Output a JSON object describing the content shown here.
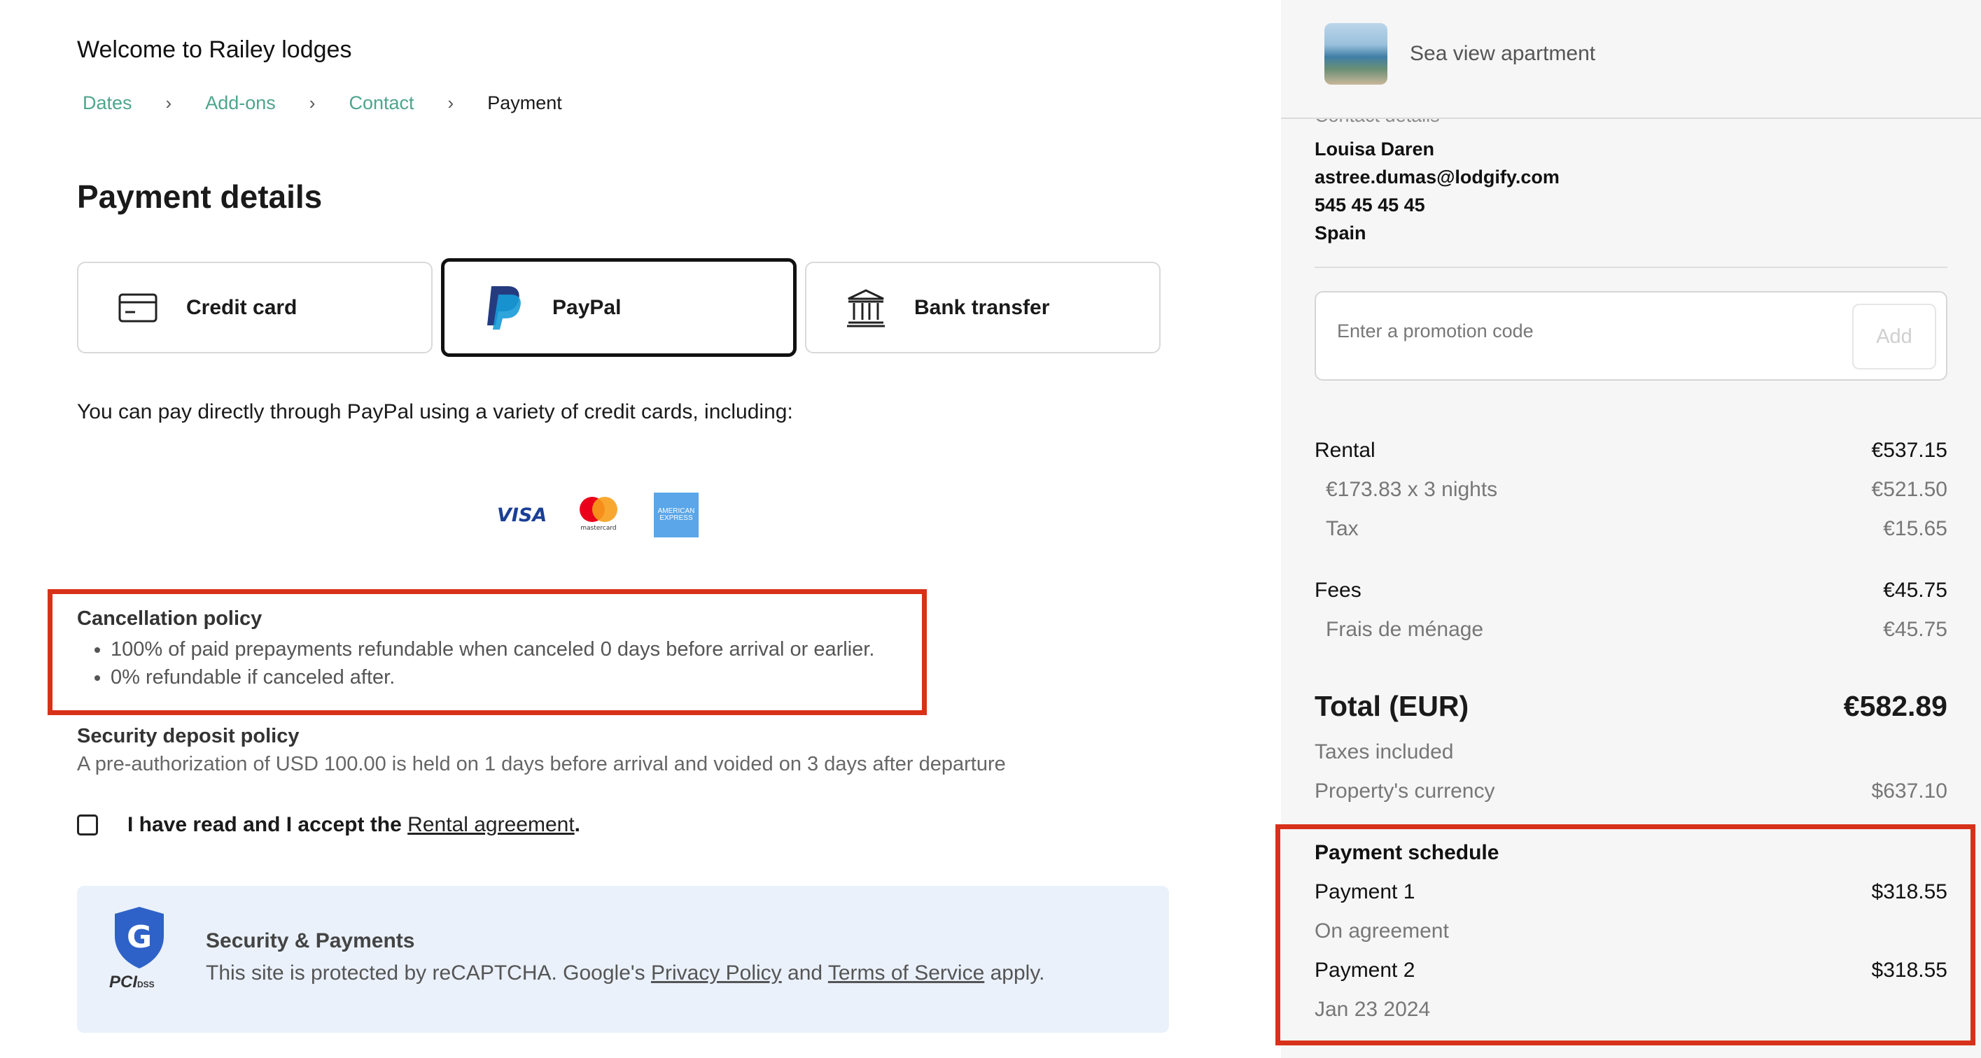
{
  "header": {
    "welcome": "Welcome to Railey lodges"
  },
  "breadcrumb": {
    "items": [
      "Dates",
      "Add-ons",
      "Contact",
      "Payment"
    ],
    "separator": "›"
  },
  "page_title": "Payment details",
  "payment_methods": [
    {
      "label": "Credit card",
      "icon": "credit-card-icon",
      "selected": false
    },
    {
      "label": "PayPal",
      "icon": "paypal-icon",
      "selected": true
    },
    {
      "label": "Bank transfer",
      "icon": "bank-icon",
      "selected": false
    }
  ],
  "paypal_description": "You can pay directly through PayPal using a variety of credit cards, including:",
  "card_logos": {
    "visa": "VISA",
    "mastercard": "mastercard",
    "amex": "AMERICAN EXPRESS"
  },
  "cancellation": {
    "title": "Cancellation policy",
    "items": [
      "100% of paid prepayments refundable when canceled 0 days before arrival or earlier.",
      "0% refundable if canceled after."
    ]
  },
  "deposit": {
    "title": "Security deposit policy",
    "text": "A pre-authorization of USD 100.00 is held on 1 days before arrival and voided on 3 days after departure"
  },
  "agreement": {
    "prefix": "I have read and I accept the ",
    "link": "Rental agreement",
    "suffix": ".",
    "checked": false
  },
  "security": {
    "title": "Security & Payments",
    "text_before": "This site is protected by reCAPTCHA. Google's ",
    "privacy_link": "Privacy Policy",
    "text_and": " and ",
    "terms_link": "Terms of Service",
    "text_after": " apply.",
    "pci_label": "PCI",
    "pci_sub": "DSS"
  },
  "summary": {
    "property_name": "Sea view apartment",
    "contact_label": "Contact details",
    "contact": {
      "name": "Louisa Daren",
      "email": "astree.dumas@lodgify.com",
      "phone": "545 45 45 45",
      "country": "Spain"
    },
    "promo": {
      "placeholder": "Enter a promotion code",
      "button": "Add"
    },
    "rental": {
      "label": "Rental",
      "amount": "€537.15"
    },
    "nightly": {
      "label": "€173.83 x 3 nights",
      "amount": "€521.50"
    },
    "tax": {
      "label": "Tax",
      "amount": "€15.65"
    },
    "fees": {
      "label": "Fees",
      "amount": "€45.75"
    },
    "cleaning": {
      "label": "Frais de ménage",
      "amount": "€45.75"
    },
    "total": {
      "label": "Total (EUR)",
      "amount": "€582.89"
    },
    "taxes_included": "Taxes included",
    "property_currency": {
      "label": "Property's currency",
      "amount": "$637.10"
    },
    "schedule": {
      "title": "Payment schedule",
      "payments": [
        {
          "label": "Payment 1",
          "amount": "$318.55",
          "when": "On agreement"
        },
        {
          "label": "Payment 2",
          "amount": "$318.55",
          "when": "Jan 23 2024"
        }
      ]
    }
  },
  "colors": {
    "accent_link": "#4ea58c",
    "highlight_red": "#d8311a",
    "security_bg": "#eaf1fb",
    "sidebar_bg": "#f6f6f6"
  }
}
